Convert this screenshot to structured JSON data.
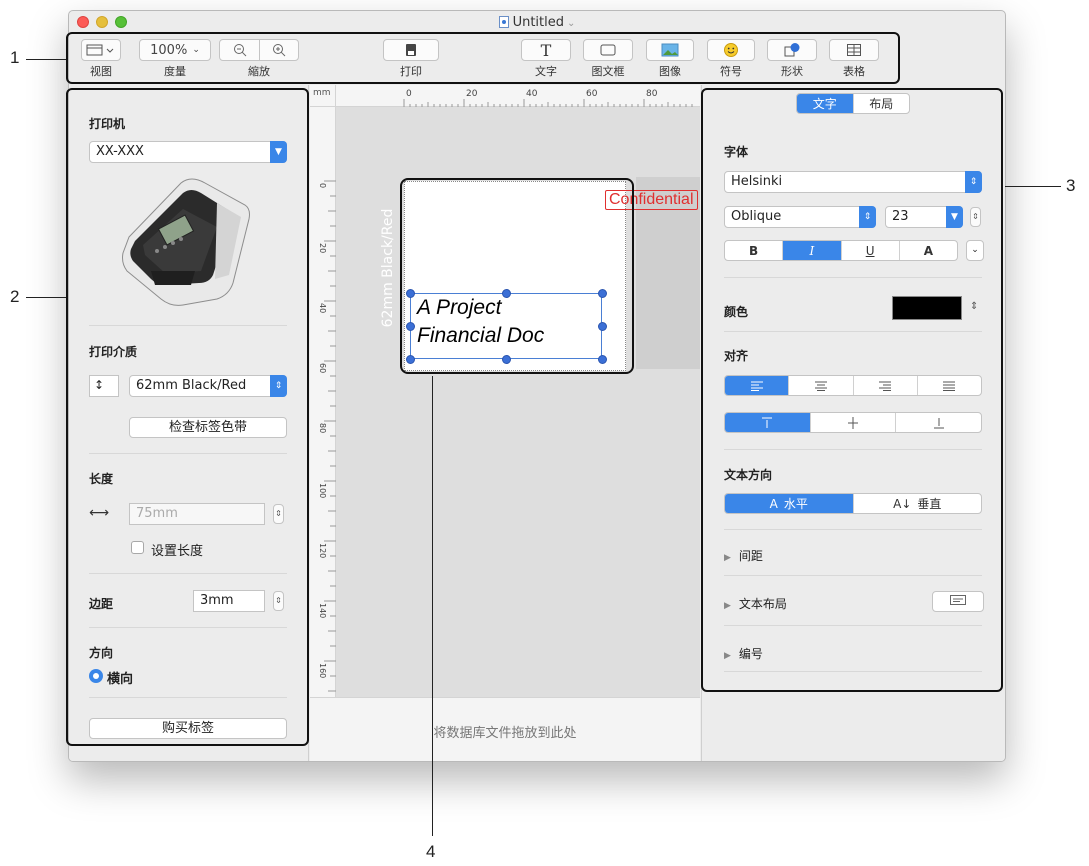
{
  "window": {
    "title": "Untitled"
  },
  "toolbar": {
    "view_label": "视图",
    "zoom_value": "100%",
    "zoom_label": "度量",
    "scale_label": "縮放",
    "print_label": "打印",
    "text_label": "文字",
    "textframe_label": "图文框",
    "image_label": "图像",
    "symbol_label": "符号",
    "shape_label": "形状",
    "table_label": "表格"
  },
  "left": {
    "printer_heading": "打印机",
    "printer_value": "XX-XXX",
    "media_heading": "打印介质",
    "media_value": "62mm Black/Red",
    "check_tape_button": "检查标签色带",
    "length_heading": "长度",
    "length_placeholder": "75mm",
    "set_length_label": "设置长度",
    "margin_label": "边距",
    "margin_value": "3mm",
    "orientation_heading": "方向",
    "orientation_option": "横向",
    "buy_labels_button": "购买标签"
  },
  "canvas": {
    "ruler_unit": "mm",
    "ruler_top_ticks": [
      "0",
      "20",
      "40",
      "60",
      "80"
    ],
    "ruler_left_ticks": [
      "0",
      "20",
      "40",
      "60",
      "80",
      "100",
      "120",
      "140",
      "160"
    ],
    "vertical_tape_label": "62mm Black/Red",
    "confidential_text": "Confidential",
    "text_line1": "A Project",
    "text_line2": "Financial Doc",
    "drop_hint": "将数据库文件拖放到此处"
  },
  "right": {
    "tab_text": "文字",
    "tab_layout": "布局",
    "font_heading": "字体",
    "font_family": "Helsinki",
    "font_style": "Oblique",
    "font_size": "23",
    "bold": "B",
    "italic": "I",
    "underline": "U",
    "outline": "A",
    "color_heading": "颜色",
    "color_value": "#000000",
    "align_heading": "对齐",
    "text_direction_heading": "文本方向",
    "horizontal_label": "水平",
    "vertical_label": "垂直",
    "spacing_label": "间距",
    "text_layout_label": "文本布局",
    "numbering_label": "编号"
  },
  "callouts": {
    "c1": "1",
    "c2": "2",
    "c3": "3",
    "c4": "4"
  }
}
